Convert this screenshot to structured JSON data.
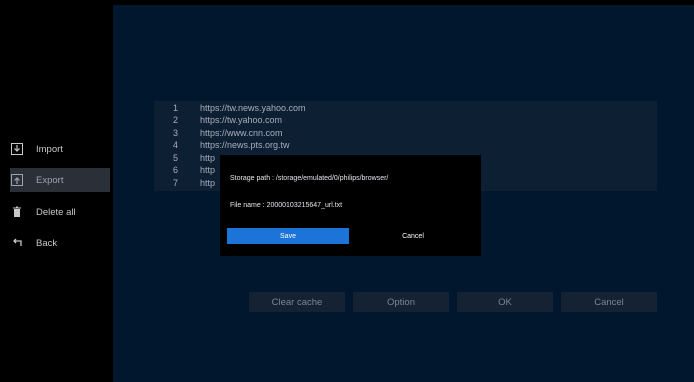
{
  "sidebar": {
    "items": [
      {
        "label": "Import",
        "icon": "import-icon"
      },
      {
        "label": "Export",
        "icon": "export-icon"
      },
      {
        "label": "Delete all",
        "icon": "trash-icon"
      },
      {
        "label": "Back",
        "icon": "back-icon"
      }
    ],
    "active_item": "Export"
  },
  "url_list": {
    "rows": [
      {
        "num": "1",
        "url": "https://tw.news.yahoo.com"
      },
      {
        "num": "2",
        "url": "https://tw.yahoo.com"
      },
      {
        "num": "3",
        "url": "https://www.cnn.com"
      },
      {
        "num": "4",
        "url": "https://news.pts.org.tw"
      },
      {
        "num": "5",
        "url": "http"
      },
      {
        "num": "6",
        "url": "http"
      },
      {
        "num": "7",
        "url": "http"
      }
    ]
  },
  "dialog": {
    "storage_path": "Storage path : /storage/emulated/0/philips/browser/",
    "file_name": "File name : 20000103215647_url.txt",
    "save_label": "Save",
    "cancel_label": "Cancel"
  },
  "bottom_buttons": {
    "clear_cache": "Clear cache",
    "option": "Option",
    "ok": "OK",
    "cancel": "Cancel"
  },
  "colors": {
    "background": "#00172e",
    "accent": "#1d74d8"
  }
}
